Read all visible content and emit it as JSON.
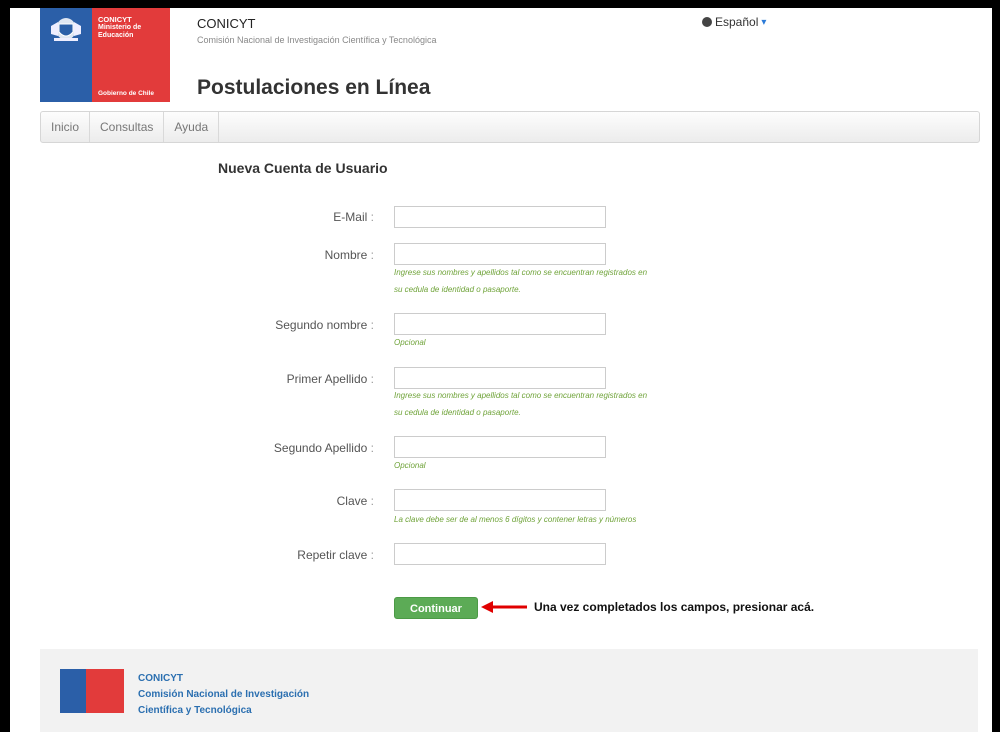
{
  "logo": {
    "org": "CONICYT",
    "ministry": "Ministerio de Educación",
    "government": "Gobierno de Chile"
  },
  "header": {
    "brand_name": "CONICYT",
    "brand_full": "Comisión Nacional de Investigación Científica y Tecnológica",
    "page_title": "Postulaciones en Línea",
    "language": "Español"
  },
  "nav": {
    "items": [
      "Inicio",
      "Consultas",
      "Ayuda"
    ]
  },
  "form": {
    "title": "Nueva Cuenta de Usuario",
    "fields": [
      {
        "label": "E-Mail",
        "value": ""
      },
      {
        "label": "Nombre",
        "value": "",
        "help": [
          "Ingrese sus nombres y apellidos tal como se encuentran registrados en",
          "su cedula de identidad o pasaporte."
        ]
      },
      {
        "label": "Segundo nombre",
        "value": "",
        "help": [
          "Opcional"
        ]
      },
      {
        "label": "Primer Apellido",
        "value": "",
        "help": [
          "Ingrese sus nombres y apellidos tal como se encuentran registrados en",
          "su cedula de identidad o pasaporte."
        ]
      },
      {
        "label": "Segundo Apellido",
        "value": "",
        "help": [
          "Opcional"
        ]
      },
      {
        "label": "Clave",
        "value": "",
        "help": [
          "La clave debe ser de al menos 6 dígitos y contener letras y números"
        ]
      },
      {
        "label": "Repetir clave",
        "value": ""
      }
    ],
    "submit_label": "Continuar",
    "annotation": "Una vez completados los campos, presionar acá.",
    "help_color": "#6fa339",
    "button_color": "#5cab56"
  },
  "footer": {
    "lines": [
      "CONICYT",
      "Comisión Nacional de Investigación",
      "Científica y Tecnológica"
    ],
    "text_color": "#2b6fb0"
  },
  "icons": {
    "language": "globe-icon",
    "dropdown": "caret-down-icon",
    "annotation_arrow": "red-arrow-icon"
  }
}
